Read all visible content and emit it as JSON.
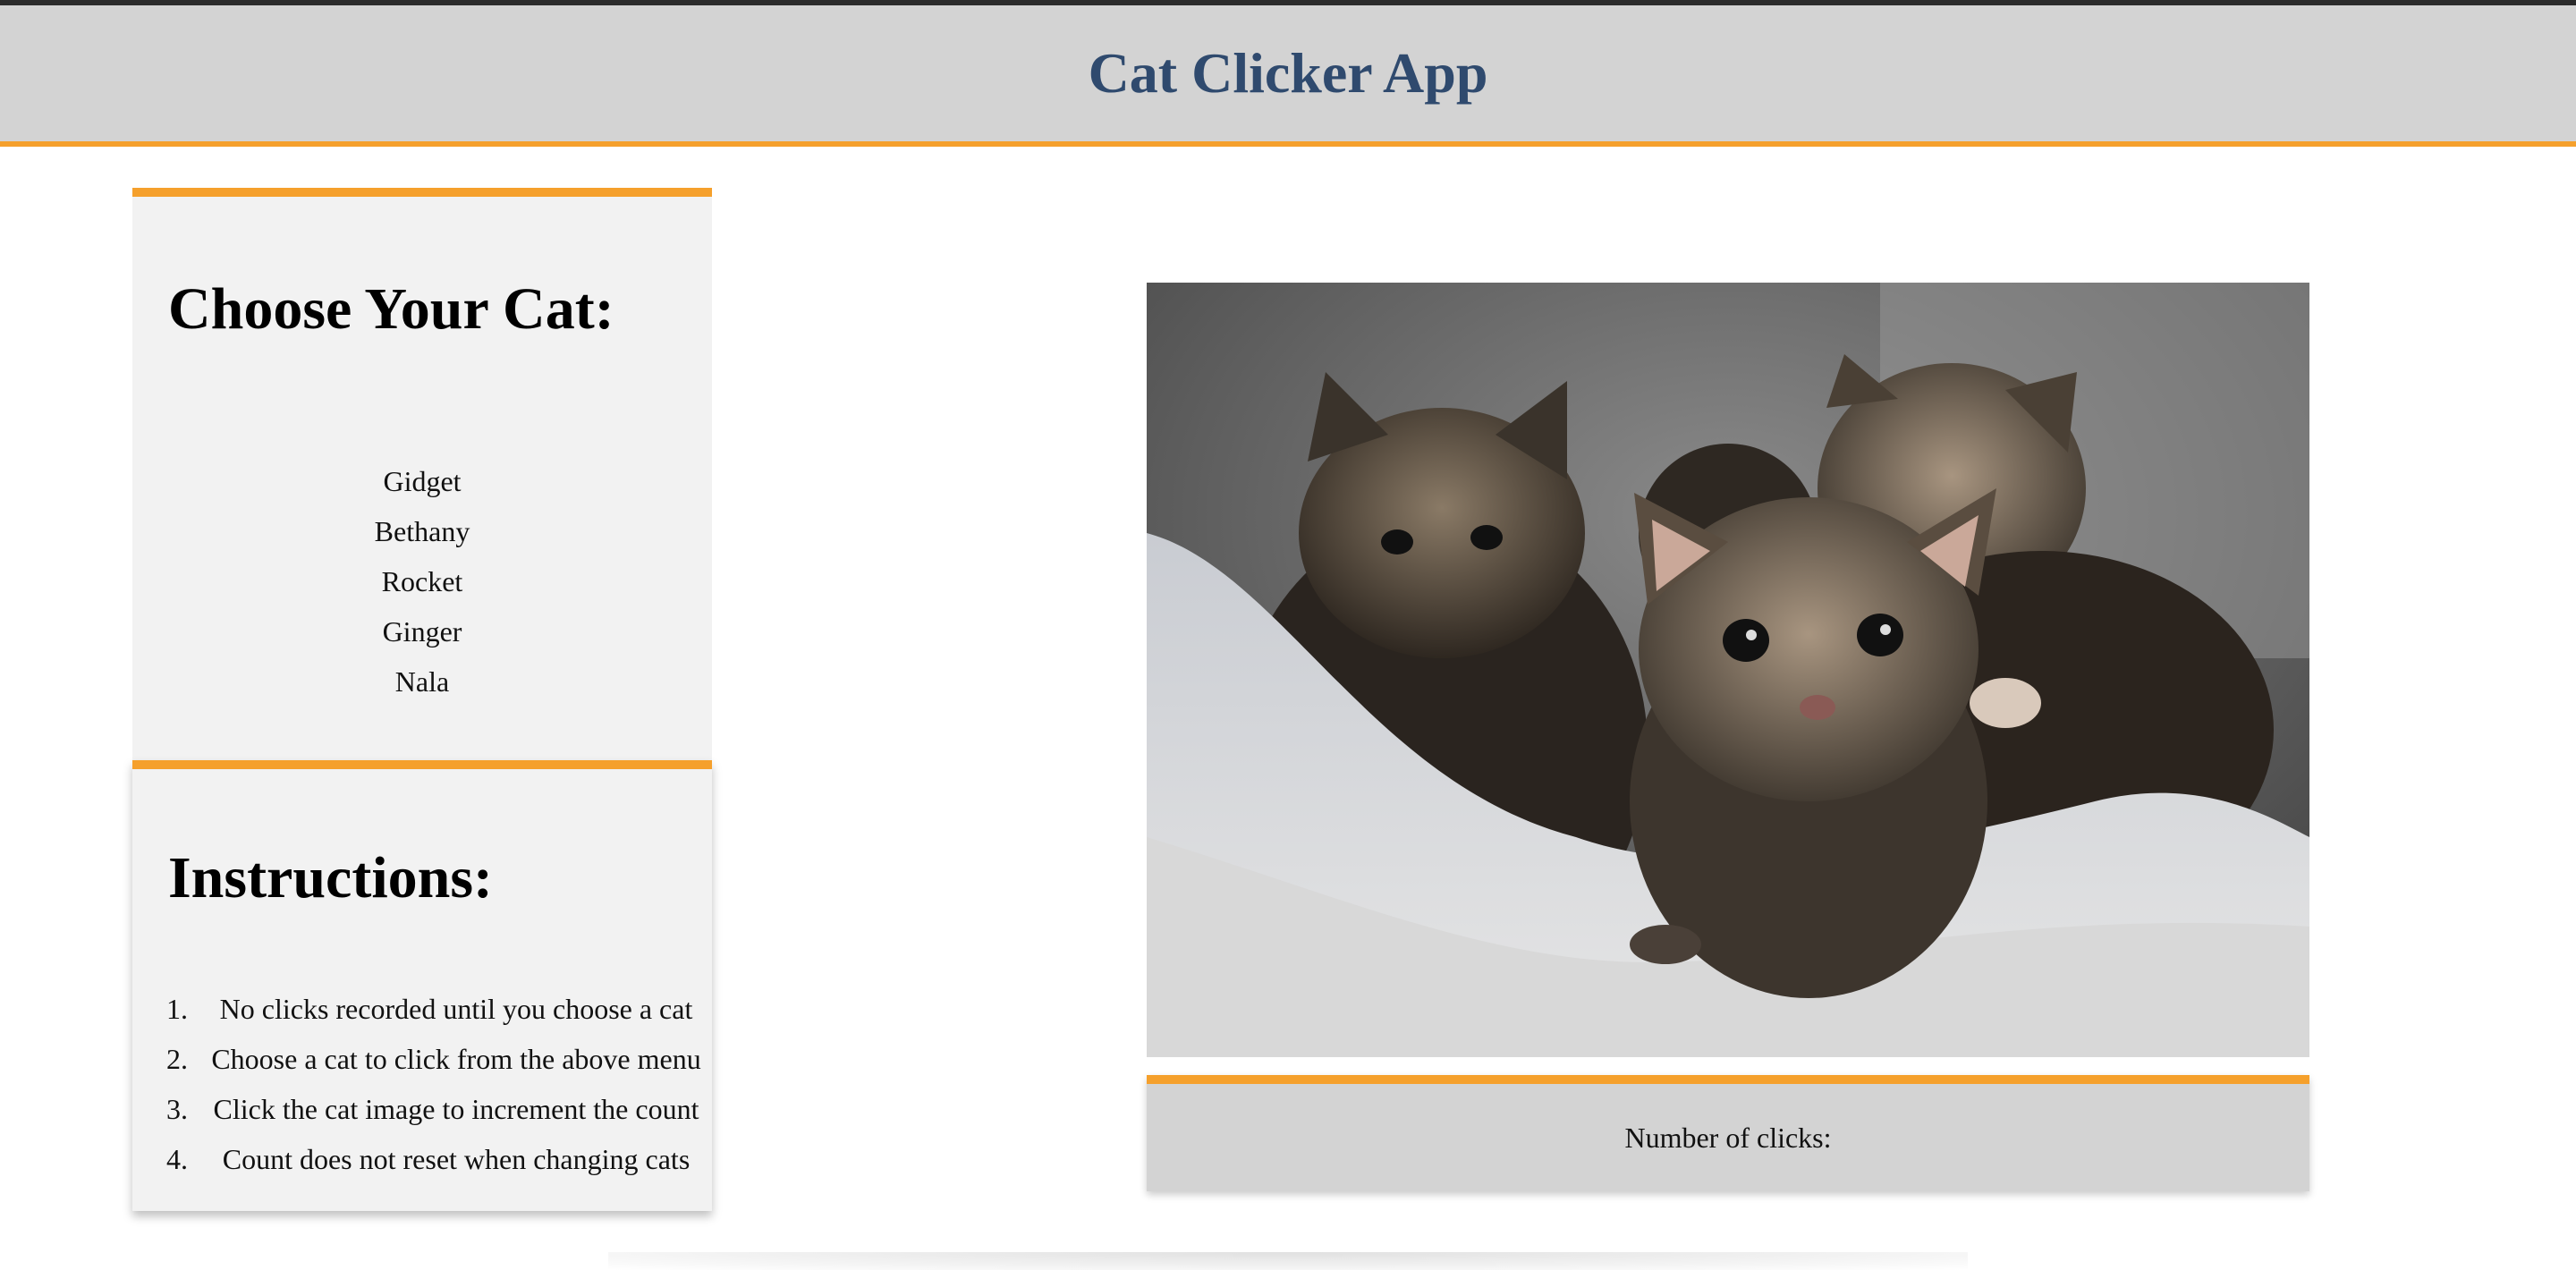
{
  "header": {
    "title": "Cat Clicker App"
  },
  "cat_menu": {
    "heading": "Choose Your Cat:",
    "cats": [
      "Gidget",
      "Bethany",
      "Rocket",
      "Ginger",
      "Nala"
    ]
  },
  "instructions": {
    "heading": "Instructions:",
    "items": [
      {
        "num": "1.",
        "text": "No clicks recorded until you choose a cat"
      },
      {
        "num": "2.",
        "text": "Choose a cat to click from the above menu"
      },
      {
        "num": "3.",
        "text": "Click the cat image to increment the count"
      },
      {
        "num": "4.",
        "text": "Count does not reset when changing cats"
      }
    ]
  },
  "cat_image": {
    "icon": "kittens-photo"
  },
  "click_counter": {
    "label": "Number of clicks:"
  },
  "colors": {
    "accent": "#f5a02c",
    "title": "#2f4a6e",
    "header_bg": "#d3d3d3",
    "panel_bg": "#f2f2f2"
  }
}
